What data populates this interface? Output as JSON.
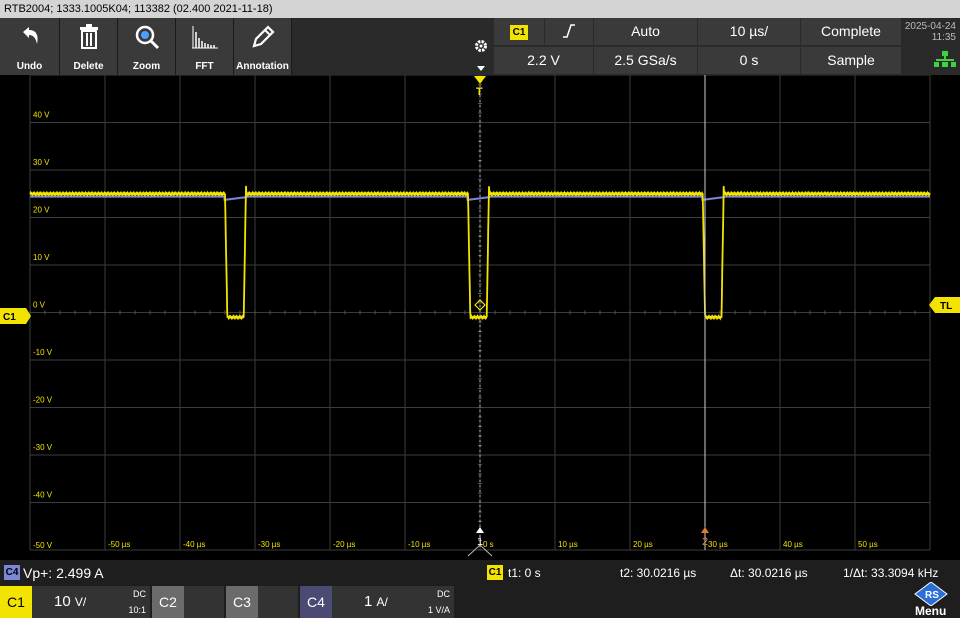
{
  "titlebar": {
    "text": "RTB2004; 1333.1005K04; 113382 (02.400 2021-11-18)"
  },
  "toolbar": {
    "undo": "Undo",
    "delete": "Delete",
    "zoom": "Zoom",
    "fft": "FFT",
    "annotation": "Annotation"
  },
  "trigger": {
    "source": "C1",
    "slope_icon": "rising-edge-icon",
    "mode": "Auto",
    "timebase": "10 µs/",
    "acq_state": "Complete",
    "level": "2.2 V",
    "sample_rate": "2.5 GSa/s",
    "position": "0 s",
    "acq_mode": "Sample"
  },
  "datetime": {
    "date": "2025-04-24",
    "time": "11:35"
  },
  "screen": {
    "y_ticks": [
      "40 V",
      "30 V",
      "20 V",
      "10 V",
      "0 V",
      "-10 V",
      "-20 V",
      "-30 V",
      "-40 V",
      "-50 V"
    ],
    "x_ticks": [
      "-50 µs",
      "-40 µs",
      "-30 µs",
      "-20 µs",
      "-10 µs",
      "0 s",
      "10 µs",
      "20 µs",
      "30 µs",
      "40 µs",
      "50 µs"
    ],
    "trigger_marker": "T",
    "ch_marker": "C1",
    "tl_marker": "TL",
    "cursor1": "1",
    "cursor2": "2"
  },
  "measure": {
    "ch": "C4",
    "vp": "Vp+: 2.499 A",
    "cursor_ch": "C1",
    "t1": "t1: 0 s",
    "t2": "t2: 30.0216 µs",
    "dt": "Δt: 30.0216 µs",
    "inv_dt": "1/Δt: 33.3094 kHz"
  },
  "channels": {
    "c1": {
      "name": "C1",
      "scale_num": "10",
      "scale_unit": "V/",
      "coupling": "DC",
      "probe": "10:1"
    },
    "c2": {
      "name": "C2"
    },
    "c3": {
      "name": "C3"
    },
    "c4": {
      "name": "C4",
      "scale_num": "1",
      "scale_unit": "A/",
      "coupling": "DC",
      "probe": "1 V/A"
    },
    "menu": "Menu"
  },
  "colors": {
    "ch1": "#f2e400",
    "ch4": "#7b86d6",
    "cursor2": "#e07a2e",
    "grid": "#3c3c3c"
  }
}
